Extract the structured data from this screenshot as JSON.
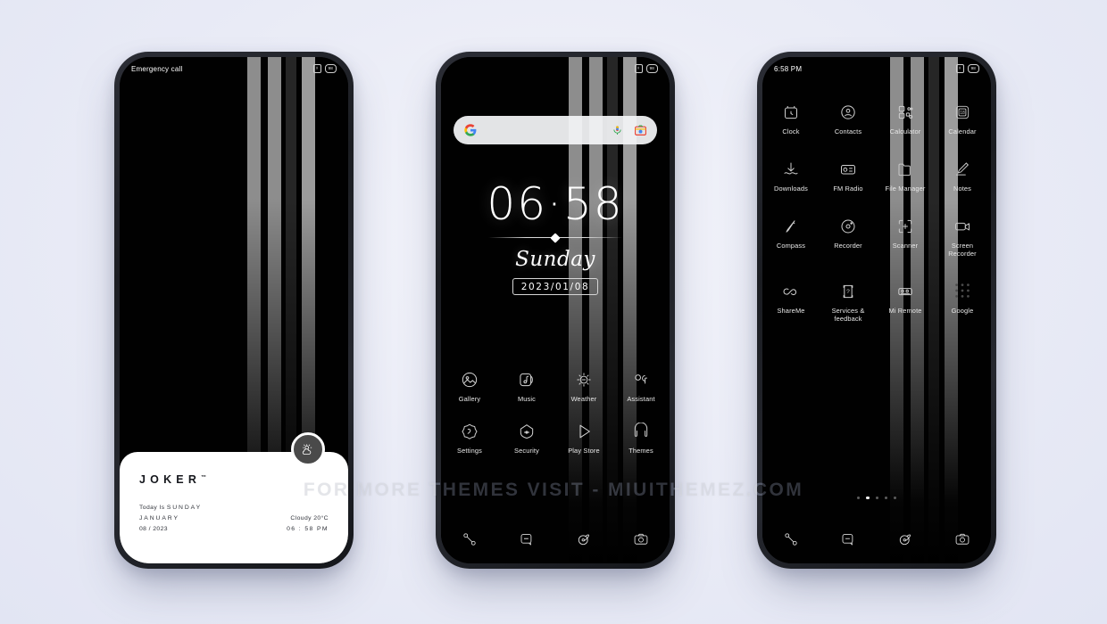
{
  "watermark": "FOR MORE THEMES VISIT - MIUITHEMEZ.COM",
  "colors": {
    "background": "#e9ebf6",
    "phone_frame": "#1b1d22",
    "screen": "#000000",
    "stripe_light": "#8d8d8d",
    "stripe_bright": "#9c9c9c",
    "stripe_dark": "#262626",
    "card": "#ffffff",
    "weather_button": "#4a4a4a",
    "accent_text": "#ffffff"
  },
  "phone1": {
    "name": "lockscreen",
    "statusbar": {
      "left": "Emergency call",
      "sim_icon": "no-sim-icon",
      "battery": "98"
    },
    "card": {
      "brand": "JOKER",
      "brand_mark": "™",
      "today_label": "Today Is",
      "today_value": "SUNDAY",
      "month": "JANUARY",
      "date": "08 / 2023",
      "weather": "Cloudy 20°C",
      "time": "06 : 58 PM"
    },
    "weather_button_icon": "sun-cloud-icon"
  },
  "phone2": {
    "name": "home-screen",
    "statusbar": {
      "left": "",
      "sim_icon": "no-sim-icon",
      "battery": "98"
    },
    "search": {
      "placeholder": "",
      "value": "",
      "logo": "google-g-icon",
      "mic": "microphone-icon",
      "lens": "google-lens-icon"
    },
    "clock": {
      "time": "06·58",
      "day": "Sunday",
      "date": "2023/01/08"
    },
    "apps": [
      {
        "label": "Gallery",
        "icon": "gallery-icon"
      },
      {
        "label": "Music",
        "icon": "music-icon"
      },
      {
        "label": "Weather",
        "icon": "weather-icon"
      },
      {
        "label": "Assistant",
        "icon": "assistant-icon"
      },
      {
        "label": "Settings",
        "icon": "settings-icon"
      },
      {
        "label": "Security",
        "icon": "security-icon"
      },
      {
        "label": "Play Store",
        "icon": "play-store-icon"
      },
      {
        "label": "Themes",
        "icon": "themes-icon"
      }
    ],
    "dock": [
      {
        "label": "Phone",
        "icon": "phone-icon"
      },
      {
        "label": "Messages",
        "icon": "messages-icon"
      },
      {
        "label": "Browser",
        "icon": "browser-icon"
      },
      {
        "label": "Camera",
        "icon": "camera-icon"
      }
    ]
  },
  "phone3": {
    "name": "app-drawer",
    "statusbar": {
      "left": "6:58 PM",
      "sim_icon": "no-sim-icon",
      "battery": "98"
    },
    "apps": [
      {
        "label": "Clock",
        "icon": "clock-icon"
      },
      {
        "label": "Contacts",
        "icon": "contacts-icon"
      },
      {
        "label": "Calculator",
        "icon": "calculator-icon"
      },
      {
        "label": "Calendar",
        "icon": "calendar-icon"
      },
      {
        "label": "Downloads",
        "icon": "downloads-icon"
      },
      {
        "label": "FM Radio",
        "icon": "fm-radio-icon"
      },
      {
        "label": "File Manager",
        "icon": "file-manager-icon"
      },
      {
        "label": "Notes",
        "icon": "notes-icon"
      },
      {
        "label": "Compass",
        "icon": "compass-icon"
      },
      {
        "label": "Recorder",
        "icon": "recorder-icon"
      },
      {
        "label": "Scanner",
        "icon": "scanner-icon"
      },
      {
        "label": "Screen Recorder",
        "icon": "screen-recorder-icon"
      },
      {
        "label": "ShareMe",
        "icon": "shareme-icon"
      },
      {
        "label": "Services & feedback",
        "icon": "services-feedback-icon"
      },
      {
        "label": "Mi Remote",
        "icon": "mi-remote-icon"
      },
      {
        "label": "Google",
        "icon": "google-folder-icon"
      }
    ],
    "page_dots": {
      "count": 5,
      "active_index": 1
    },
    "dock": [
      {
        "label": "Phone",
        "icon": "phone-icon"
      },
      {
        "label": "Messages",
        "icon": "messages-icon"
      },
      {
        "label": "Browser",
        "icon": "browser-icon"
      },
      {
        "label": "Camera",
        "icon": "camera-icon"
      }
    ]
  }
}
